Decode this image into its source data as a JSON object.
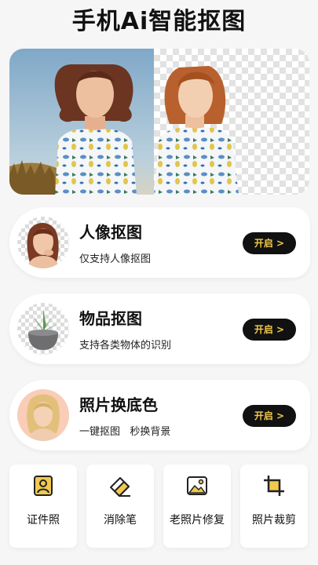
{
  "header": {
    "title": "手机Ai智能抠图"
  },
  "hero": {
    "image": "before-after-cutout-preview"
  },
  "features": [
    {
      "title": "人像抠图",
      "subtitle": "仅支持人像抠图",
      "button": "开启 >",
      "icon": "portrait-avatar"
    },
    {
      "title": "物品抠图",
      "subtitle": "支持各类物体的识别",
      "button": "开启 >",
      "icon": "potted-plant"
    },
    {
      "title": "照片换底色",
      "subtitle": "一键抠图   秒换背景",
      "button": "开启 >",
      "icon": "portrait-peach-background"
    }
  ],
  "tools": [
    {
      "label": "证件照",
      "icon": "id-photo-icon"
    },
    {
      "label": "消除笔",
      "icon": "eraser-icon"
    },
    {
      "label": "老照片修复",
      "icon": "photo-restore-icon"
    },
    {
      "label": "照片裁剪",
      "icon": "crop-icon"
    }
  ],
  "colors": {
    "accent": "#f2c94c",
    "button_bg": "#111111",
    "peach": "#f9cdb8"
  }
}
